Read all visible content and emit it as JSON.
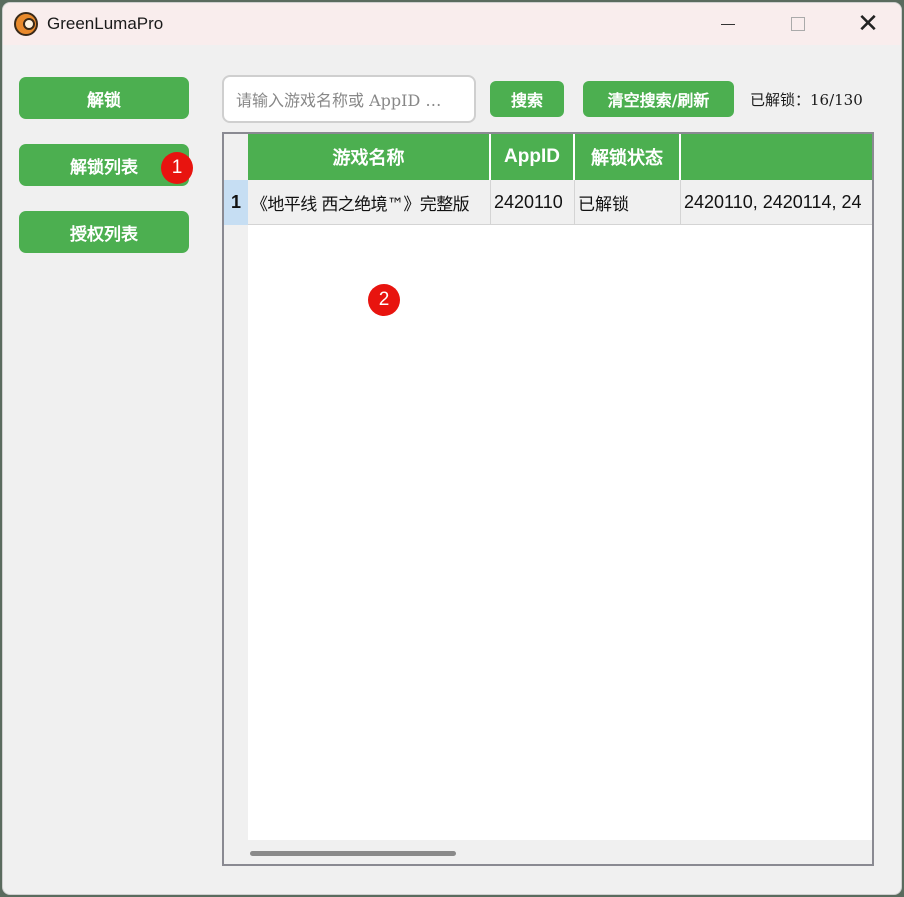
{
  "window": {
    "title": "GreenLumaPro",
    "app_icon": "steam-logo-icon",
    "controls": {
      "minimize": "minimize-icon",
      "maximize": "maximize-icon",
      "close": "✕"
    }
  },
  "sidebar": {
    "items": [
      {
        "label": "解锁"
      },
      {
        "label": "解锁列表"
      },
      {
        "label": "授权列表"
      }
    ]
  },
  "markers": [
    "1",
    "2"
  ],
  "toolbar": {
    "search_placeholder": "请输入游戏名称或 AppID …",
    "search_label": "搜索",
    "clear_label": "清空搜索/刷新",
    "unlock_count": "已解锁：16/130"
  },
  "table": {
    "columns": [
      "游戏名称",
      "AppID",
      "解锁状态",
      ""
    ],
    "rows": [
      {
        "index": "1",
        "cells": [
          "《地平线 西之绝境™》完整版",
          "2420110",
          "已解锁",
          "2420110, 2420114, 24"
        ]
      }
    ]
  },
  "colors": {
    "accent": "#4caf50",
    "marker": "#e8140f",
    "selected_row_header": "#c6def3"
  }
}
